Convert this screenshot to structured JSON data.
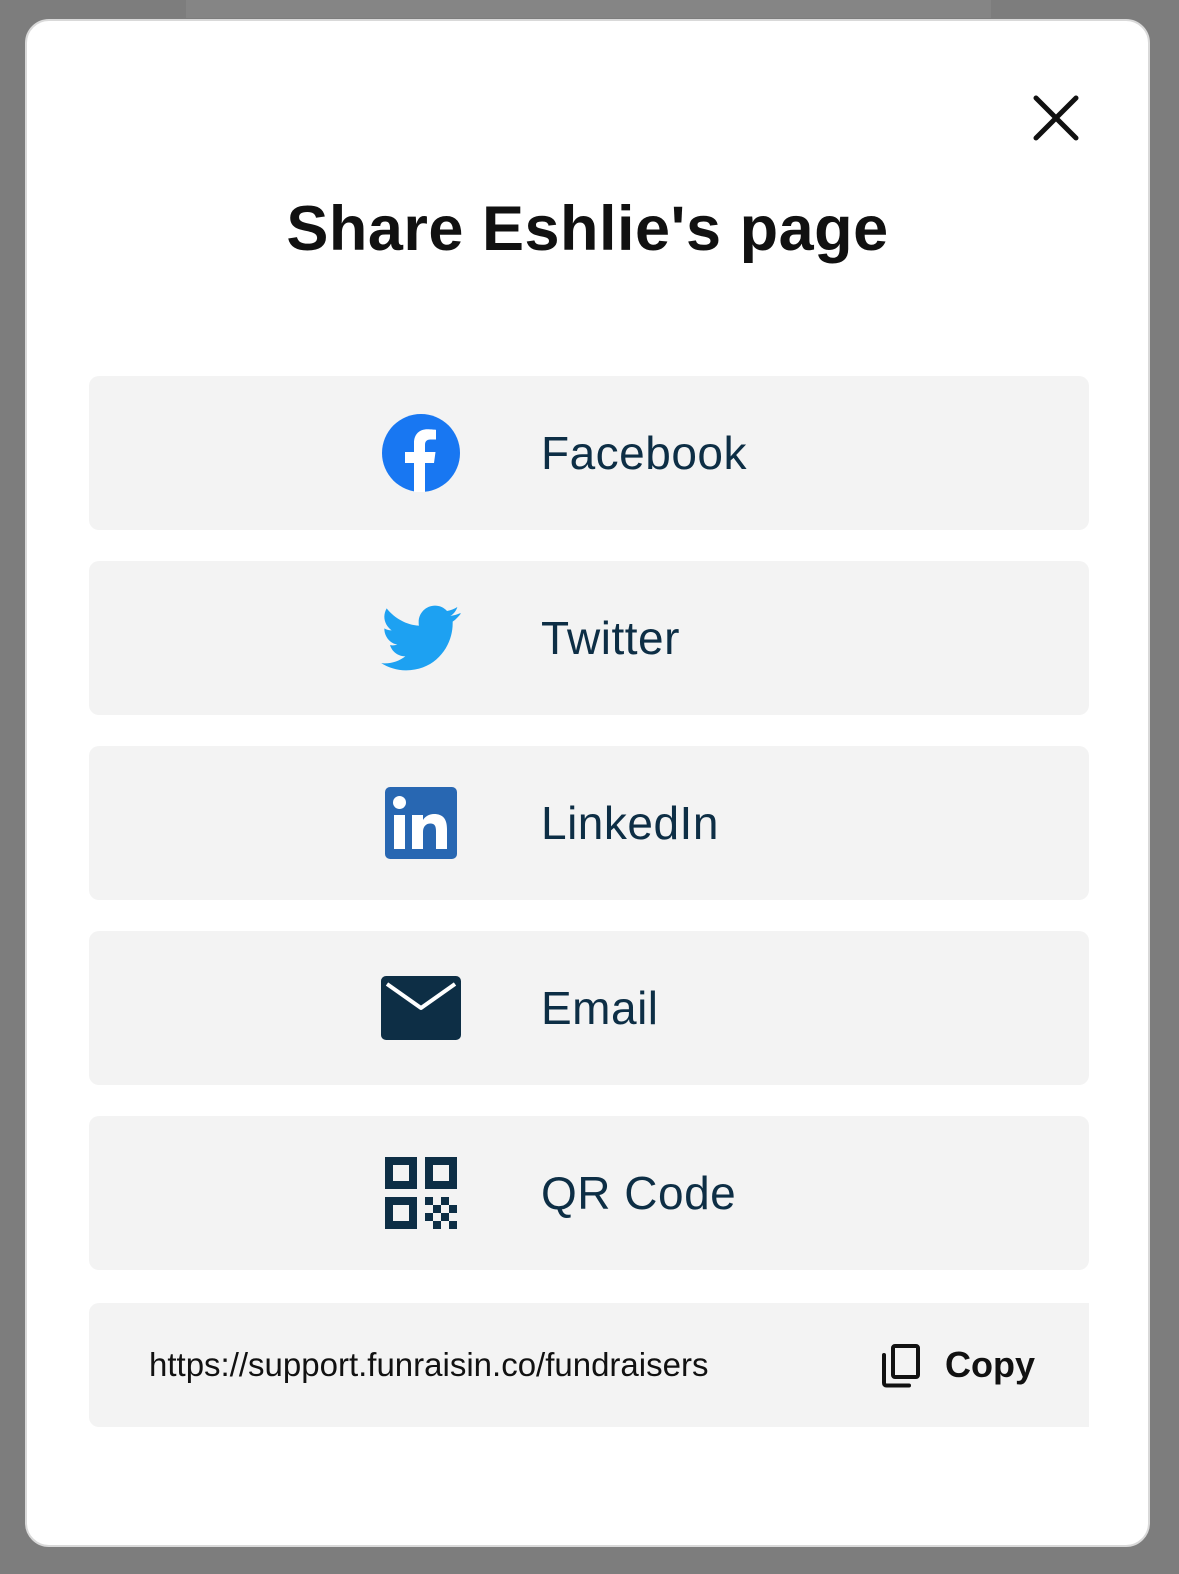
{
  "modal": {
    "title": "Share Eshlie's page",
    "close_icon": "close-icon"
  },
  "share_options": [
    {
      "label": "Facebook",
      "icon": "facebook-icon",
      "color": "#1877F2"
    },
    {
      "label": "Twitter",
      "icon": "twitter-icon",
      "color": "#1DA1F2"
    },
    {
      "label": "LinkedIn",
      "icon": "linkedin-icon",
      "color": "#2867B2"
    },
    {
      "label": "Email",
      "icon": "envelope-icon",
      "color": "#0D2E45"
    },
    {
      "label": "QR Code",
      "icon": "qr-code-icon",
      "color": "#0D2E45"
    }
  ],
  "link": {
    "url": "https://support.funraisin.co/fundraisers",
    "copy_label": "Copy",
    "copy_icon": "copy-icon"
  },
  "colors": {
    "label_text": "#0D2E45",
    "item_background": "#F3F3F3",
    "overlay": "#7D7D7D"
  }
}
